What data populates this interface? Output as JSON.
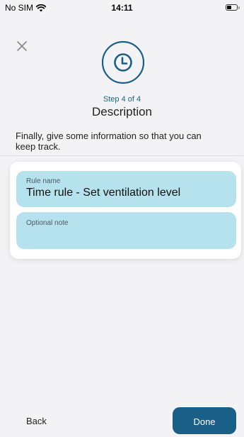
{
  "status_bar": {
    "carrier": "No SIM",
    "time": "14:11",
    "wifi_icon": "wifi-icon",
    "battery_icon": "battery-icon"
  },
  "header": {
    "close_icon": "close-icon",
    "step_icon": "clock-icon",
    "step_label": "Step 4 of 4",
    "title": "Description"
  },
  "intro": {
    "text": "Finally, give some information so that you can keep track."
  },
  "form": {
    "rule_name": {
      "label": "Rule name",
      "value": "Time rule - Set ventilation level"
    },
    "note": {
      "label": "Optional note",
      "value": ""
    }
  },
  "footer": {
    "back_label": "Back",
    "done_label": "Done"
  },
  "colors": {
    "accent": "#1a5f88",
    "field_background": "#b6e2ed",
    "page_background": "#f3f3f5"
  }
}
